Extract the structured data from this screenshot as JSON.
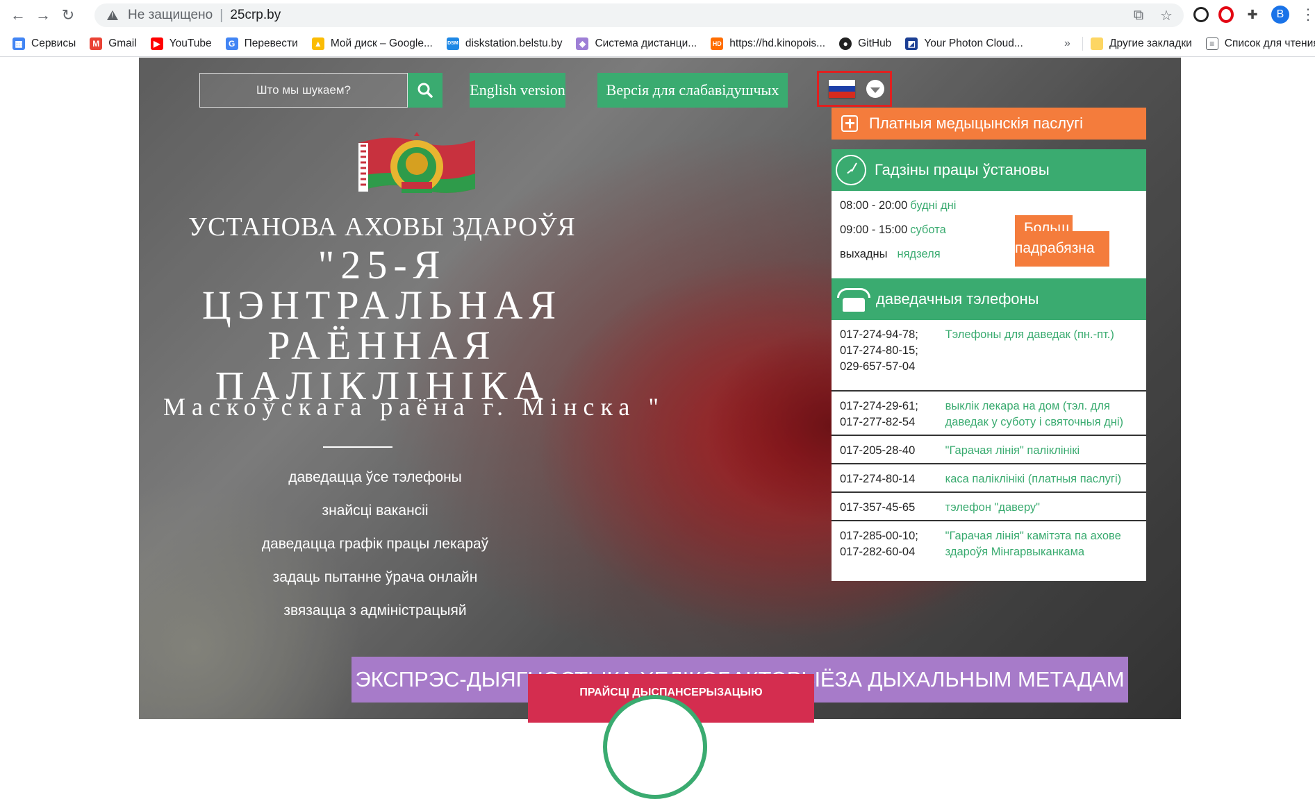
{
  "browser": {
    "address": {
      "security": "Не защищено",
      "url": "25crp.by"
    },
    "bookmarks": [
      {
        "label": "Сервисы",
        "icon": "apps-grid-icon",
        "color": "#4285f4"
      },
      {
        "label": "Gmail",
        "icon": "gmail-icon",
        "color": "#ea4335"
      },
      {
        "label": "YouTube",
        "icon": "youtube-icon",
        "color": "#ff0000"
      },
      {
        "label": "Перевести",
        "icon": "translate-icon",
        "color": "#4285f4"
      },
      {
        "label": "Мой диск – Google...",
        "icon": "google-drive-icon",
        "color": "#fbbc04"
      },
      {
        "label": "diskstation.belstu.by",
        "icon": "dsm-icon",
        "color": "#1e88e5"
      },
      {
        "label": "Система дистанци...",
        "icon": "moodle-icon",
        "color": "#9e7fd6"
      },
      {
        "label": "https://hd.kinopois...",
        "icon": "hd-icon",
        "color": "#ff6d00"
      },
      {
        "label": "GitHub",
        "icon": "github-icon",
        "color": "#222222"
      },
      {
        "label": "Your Photon Cloud...",
        "icon": "photon-icon",
        "color": "#1c3f94"
      }
    ],
    "more": "»",
    "other_bookmarks": "Другие закладки",
    "reading_list": "Список для чтения",
    "profile_letter": "В"
  },
  "header": {
    "search_placeholder": "Што мы шукаем?",
    "english_btn": "English version",
    "low_vision_btn": "Версія для слабавідушчых"
  },
  "hero": {
    "title_line1": "УСТАНОВА АХОВЫ ЗДАРОЎЯ",
    "title_line2": "\"25-Я ЦЭНТРАЛЬНАЯ РАЁННАЯ ПАЛІКЛІНІКА",
    "title_line3": "Маскоўскага раёна г. Мінска \"",
    "links": [
      "даведацца ўсе тэлефоны",
      "знайсці вакансіі",
      "даведацца графік працы лекараў",
      "задаць пытанне ўрача онлайн",
      "звязацца з адміністрацыяй"
    ]
  },
  "panel": {
    "paid_services": "Платныя медыцынскія паслугі",
    "hours_title": "Гадзіны працы ўстановы",
    "hours": [
      {
        "time": "08:00 - 20:00",
        "day": "будні дні"
      },
      {
        "time": "09:00 - 15:00",
        "day": "субота"
      },
      {
        "time": "выхадны",
        "day": "нядзеля"
      }
    ],
    "more_line1": "Больш",
    "more_line2": "падрабязна",
    "phones_title": "даведачныя тэлефоны",
    "phones": [
      {
        "numbers": "017-274-94-78;\n017-274-80-15;\n029-657-57-04",
        "desc": "Тэлефоны для даведак (пн.-пт.)"
      },
      {
        "numbers": "017-274-29-61;\n017-277-82-54",
        "desc": "выклік лекара на дом (тэл. для даведак у суботу і святочныя дні)"
      },
      {
        "numbers": "017-205-28-40",
        "desc": "\"Гарачая лінія\" паліклінікі"
      },
      {
        "numbers": "017-274-80-14",
        "desc": "каса паліклінікі (платныя паслугі)"
      },
      {
        "numbers": "017-357-45-65",
        "desc": "тэлефон \"даверу\""
      },
      {
        "numbers": "017-285-00-10;\n017-282-60-04",
        "desc": "\"Гарачая лінія\" камітэта па ахове здароўя Мінгарвыканкама"
      }
    ]
  },
  "banners": {
    "purple": "ЭКСПРЭС-ДЫЯГНОСТЫКА ХЕЛІКОБАКТЭРЫЁЗА ДЫХАЛЬНЫМ МЕТАДАМ",
    "pink": "ПРАЙСЦІ ДЫСПАНСЕРЫЗАЦЫЮ"
  },
  "colors": {
    "green": "#3aab70",
    "orange": "#f47c3c",
    "purple": "#a77bc9",
    "pink": "#d42d4f",
    "highlight": "#e02020"
  }
}
